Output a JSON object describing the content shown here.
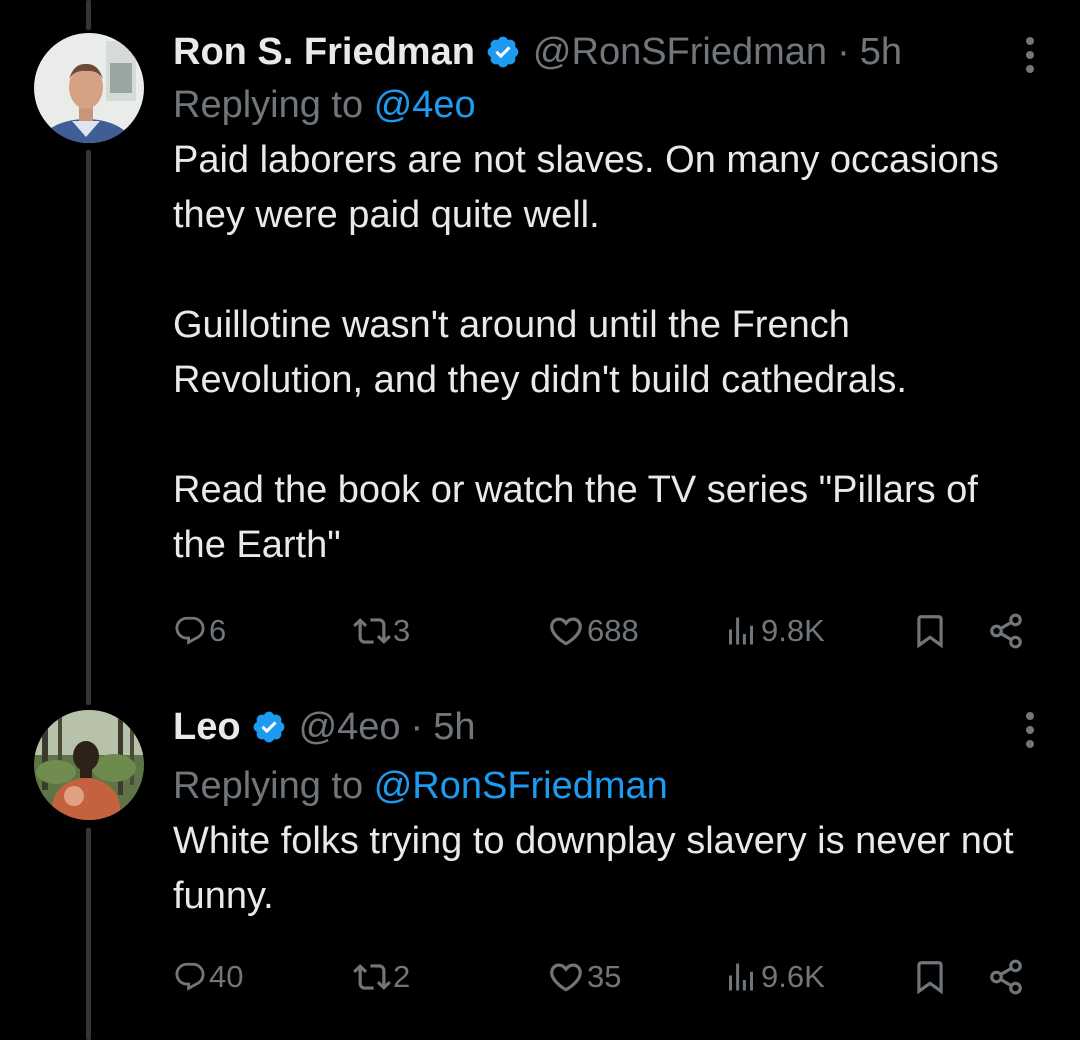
{
  "tweets": [
    {
      "name": "Ron S. Friedman",
      "handle": "@RonSFriedman",
      "separator": "·",
      "time": "5h",
      "replying_prefix": "Replying to",
      "replying_to": "@4eo",
      "paragraphs": [
        "Paid laborers are not slaves. On many occasions they were paid quite well.",
        "Guillotine wasn't around until the French Revolution, and they didn't build cathedrals.",
        "Read the book or watch the TV series \"Pillars of the Earth\""
      ],
      "stats": {
        "replies": "6",
        "reposts": "3",
        "likes": "688",
        "views": "9.8K"
      }
    },
    {
      "name": "Leo",
      "handle": "@4eo",
      "separator": "·",
      "time": "5h",
      "replying_prefix": "Replying to",
      "replying_to": "@RonSFriedman",
      "paragraphs": [
        "White folks trying to downplay slavery is never not funny."
      ],
      "stats": {
        "replies": "40",
        "reposts": "2",
        "likes": "35",
        "views": "9.6K"
      }
    }
  ],
  "colors": {
    "background": "#000000",
    "text": "#e7e9ea",
    "muted": "#71767b",
    "link": "#1d9bf0",
    "verified": "#1d9bf0",
    "thread_line": "#333639"
  },
  "icons": {
    "reply": "reply-icon",
    "repost": "repost-icon",
    "like": "like-icon",
    "views": "views-icon",
    "bookmark": "bookmark-icon",
    "share": "share-icon",
    "verified": "verified-badge-icon",
    "more": "more-icon"
  }
}
